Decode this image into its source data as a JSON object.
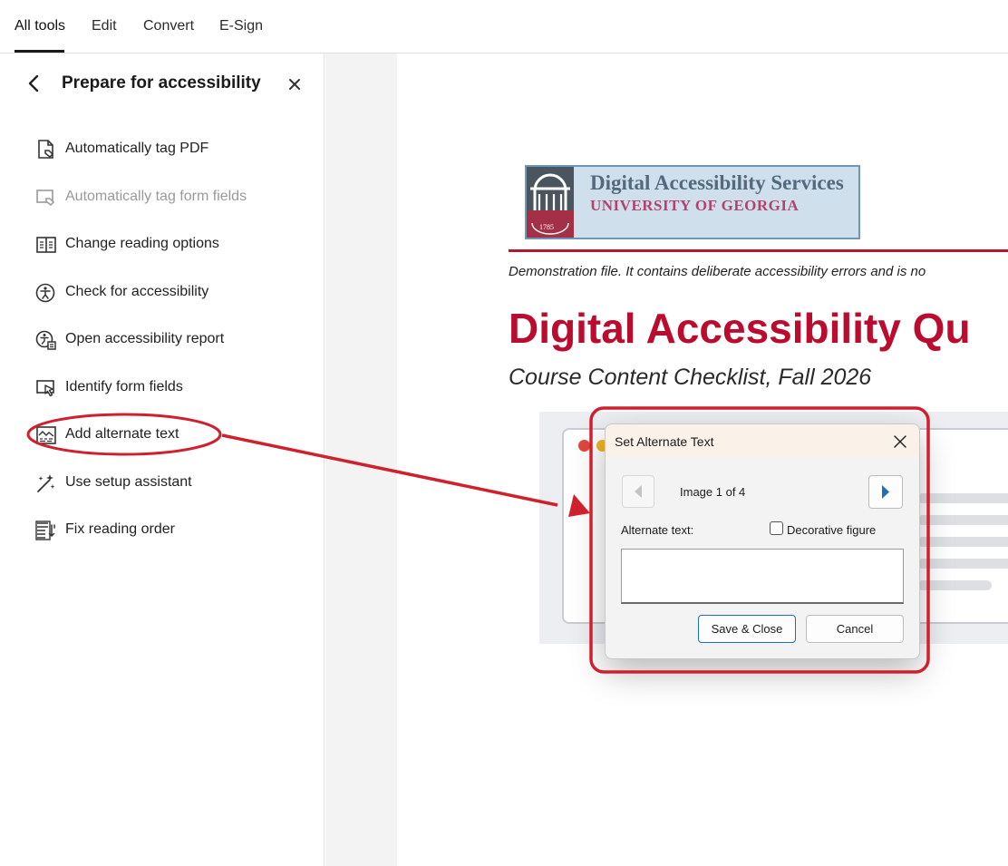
{
  "menubar": {
    "items": [
      "All tools",
      "Edit",
      "Convert",
      "E-Sign"
    ],
    "active_index": 0
  },
  "sidebar": {
    "title": "Prepare for accessibility",
    "tools": [
      {
        "label": "Automatically tag PDF",
        "icon": "tag-pdf-icon",
        "enabled": true
      },
      {
        "label": "Automatically tag form fields",
        "icon": "tag-form-fields-icon",
        "enabled": false
      },
      {
        "label": "Change reading options",
        "icon": "book-icon",
        "enabled": true
      },
      {
        "label": "Check for accessibility",
        "icon": "accessibility-icon",
        "enabled": true
      },
      {
        "label": "Open accessibility report",
        "icon": "accessibility-report-icon",
        "enabled": true
      },
      {
        "label": "Identify form fields",
        "icon": "identify-fields-icon",
        "enabled": true
      },
      {
        "label": "Add alternate text",
        "icon": "alt-text-icon",
        "enabled": true
      },
      {
        "label": "Use setup assistant",
        "icon": "magic-wand-icon",
        "enabled": true
      },
      {
        "label": "Fix reading order",
        "icon": "reading-order-icon",
        "enabled": true
      }
    ]
  },
  "document": {
    "logo_line1": "Digital Accessibility Services",
    "logo_line2": "UNIVERSITY OF GEORGIA",
    "logo_year": "1785",
    "note": "Demonstration file. It contains deliberate accessibility errors and is no",
    "title": "Digital Accessibility Qu",
    "subtitle": "Course Content Checklist, Fall 2026"
  },
  "dialog": {
    "title": "Set Alternate Text",
    "image_counter": "Image 1 of 4",
    "alt_label": "Alternate text:",
    "alt_value": "",
    "decorative_label": "Decorative figure",
    "decorative_checked": false,
    "save_label": "Save & Close",
    "cancel_label": "Cancel"
  },
  "colors": {
    "annotation_red": "#d0202e",
    "uga_red": "#ba0c2f",
    "logo_blue": "#52697e",
    "logo_rose": "#b0446d",
    "primary_button_border": "#1e6fb8"
  }
}
